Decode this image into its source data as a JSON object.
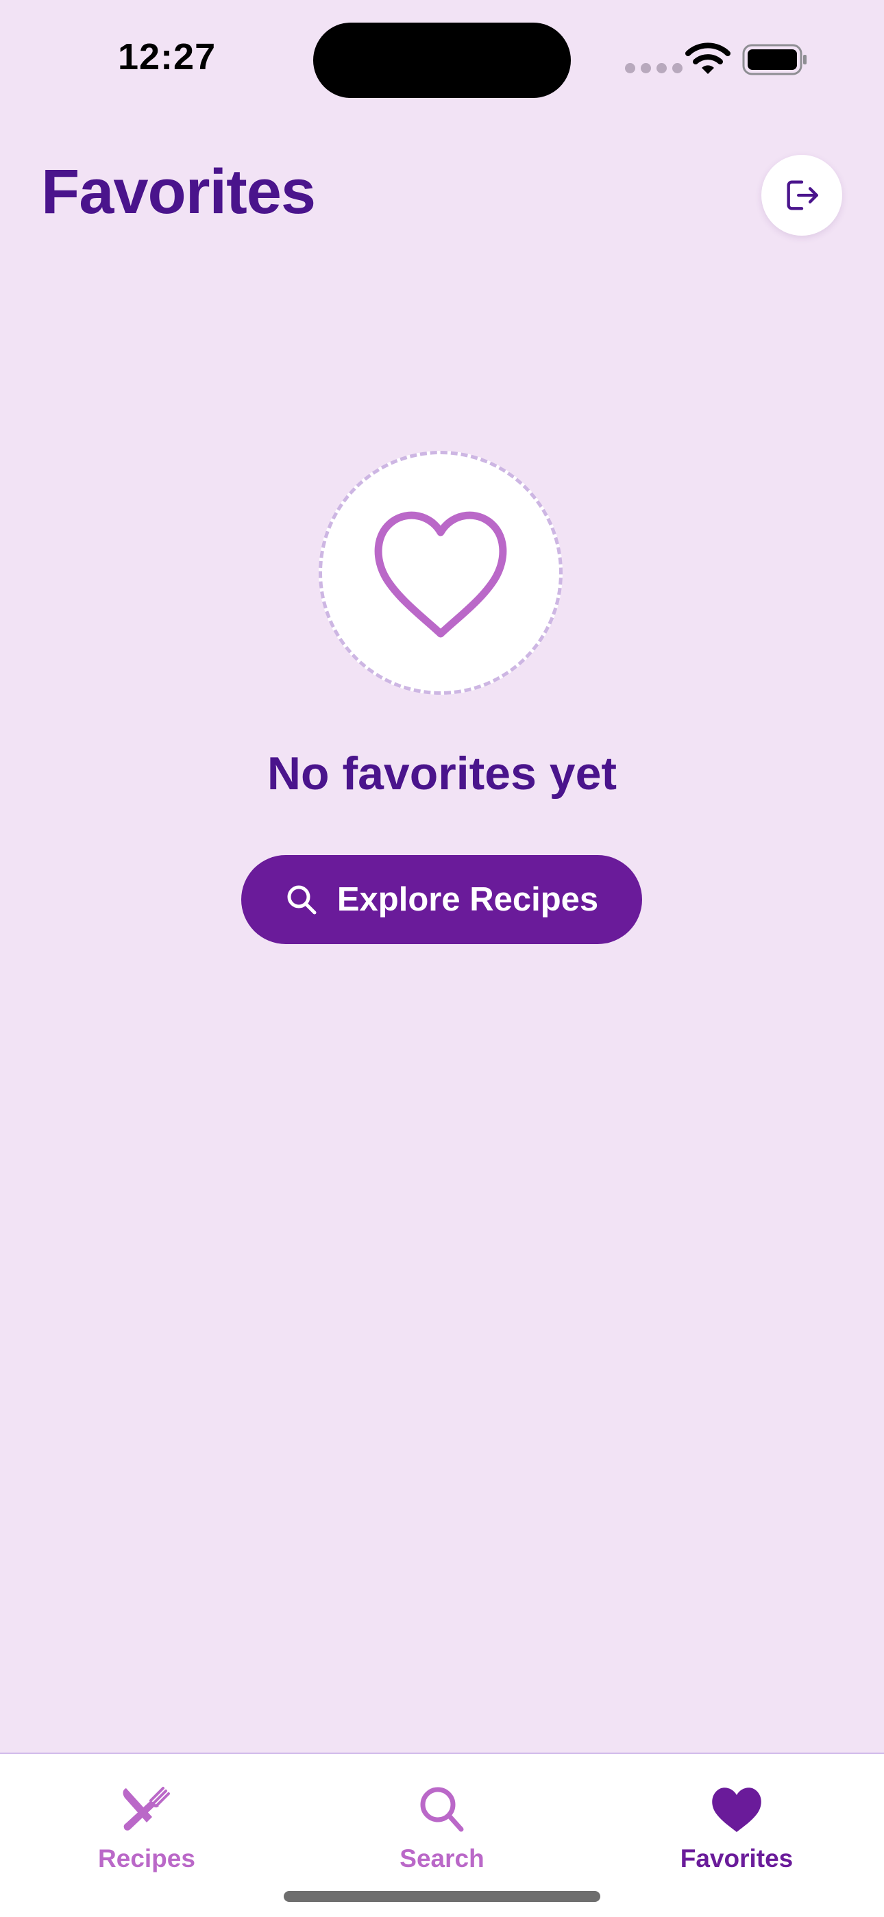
{
  "status_bar": {
    "time": "12:27",
    "icons": [
      "cellular-signal-icon",
      "wifi-icon",
      "battery-icon"
    ]
  },
  "header": {
    "title": "Favorites",
    "logout_icon": "logout-icon"
  },
  "empty_state": {
    "icon": "heart-outline-icon",
    "title": "No favorites yet",
    "button_label": "Explore Recipes",
    "button_icon": "search-icon"
  },
  "tab_bar": {
    "items": [
      {
        "label": "Recipes",
        "icon": "fork-knife-icon",
        "active": false
      },
      {
        "label": "Search",
        "icon": "search-icon",
        "active": false
      },
      {
        "label": "Favorites",
        "icon": "heart-icon",
        "active": true
      }
    ]
  },
  "colors": {
    "background": "#F2E3F5",
    "primary": "#6A1B9A",
    "title": "#4A148C",
    "accent": "#BA68C8",
    "surface": "#FFFFFF"
  }
}
